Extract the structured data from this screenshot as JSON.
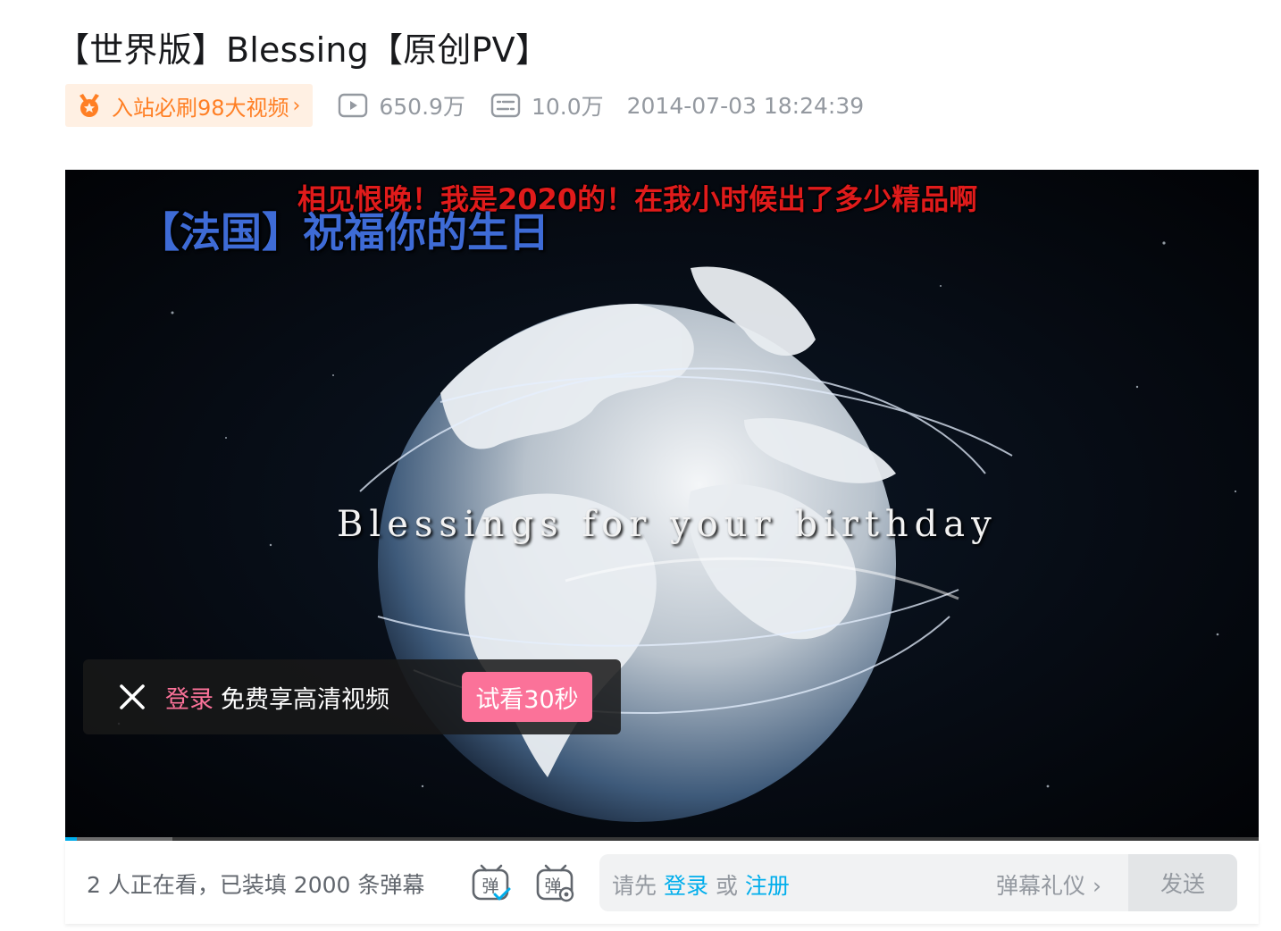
{
  "video": {
    "title": "【世界版】Blessing【原创PV】",
    "honor_label": "入站必刷98大视频",
    "honor_arrow": "›",
    "views": "650.9万",
    "danmaku_count": "10.0万",
    "pubdate": "2014-07-03 18:24:39"
  },
  "player": {
    "danmaku_text": "相见恨晚！我是2020的！在我小时候出了多少精品啊",
    "caption_cn": "【法国】祝福你的生日",
    "caption_en": "Blessings for your birthday",
    "progress_played": 0.01,
    "progress_buffered": 0.09,
    "login_toast": {
      "login_link": "登录",
      "text": "免费享高清视频",
      "trial_button": "试看30秒"
    }
  },
  "sendbar": {
    "viewer_info": "2 人正在看，已装填 2000 条弹幕",
    "hint_prefix": "请先",
    "hint_login": "登录",
    "hint_or": "或",
    "hint_register": "注册",
    "etiquette": "弹幕礼仪 ›",
    "send_label": "发送"
  },
  "colors": {
    "brand_pink": "#fb7299",
    "brand_blue": "#00aeec",
    "honor_orange": "#ff7f24",
    "danmaku_red": "#e01b1b"
  },
  "icons": {
    "honor": "medal-icon",
    "views": "play-count-icon",
    "danmaku": "danmaku-count-icon",
    "toast_close": "close-icon",
    "dm_toggle": "danmaku-toggle-icon",
    "dm_settings": "danmaku-settings-icon"
  }
}
